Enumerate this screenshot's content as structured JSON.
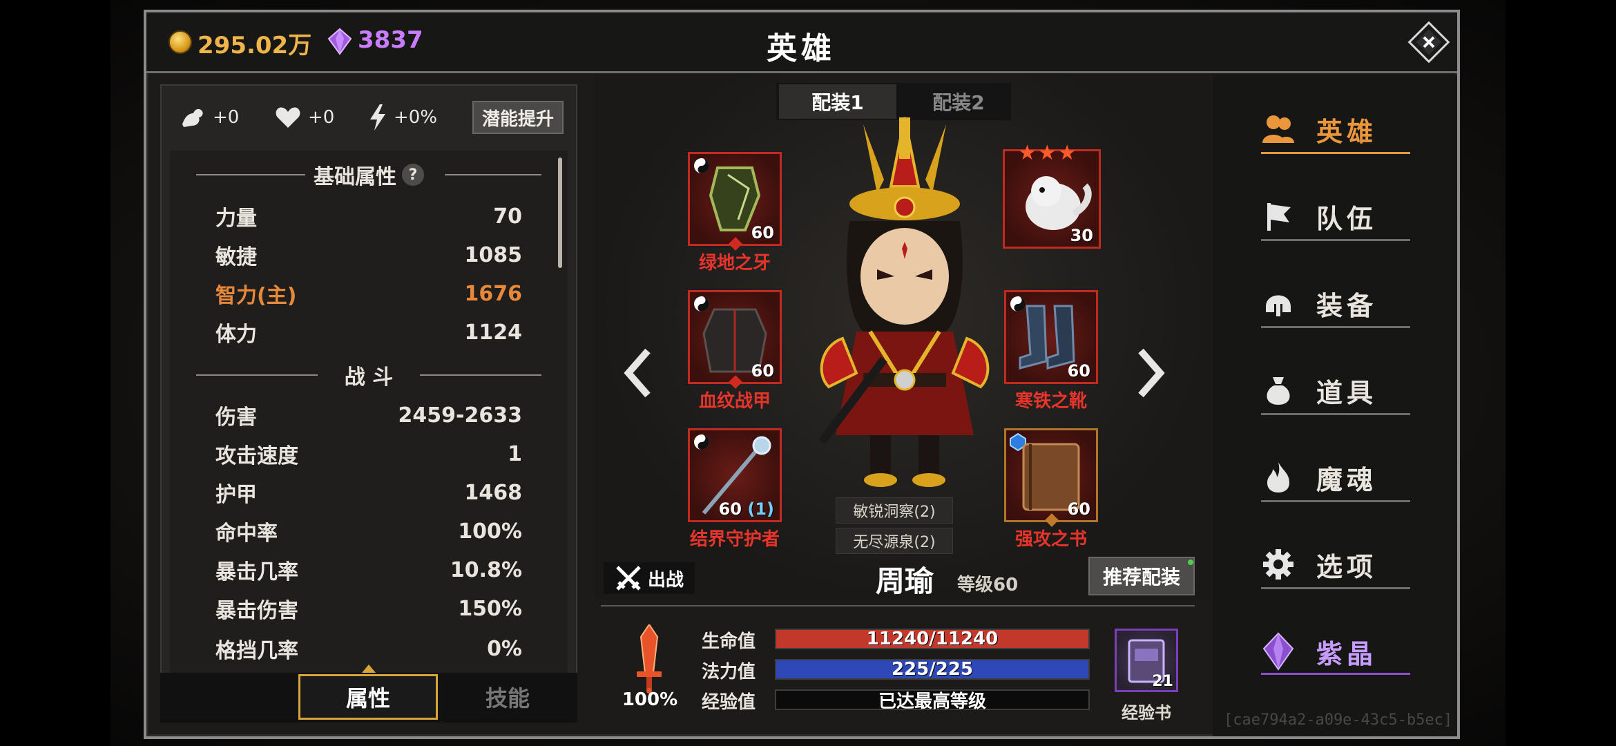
{
  "currency": {
    "gold": "295.02万",
    "gems": "3837"
  },
  "title": "英雄",
  "potential": {
    "strength_bonus": "+0",
    "health_bonus": "+0",
    "speed_bonus": "+0%",
    "upgrade_button": "潜能提升"
  },
  "basic_attributes": {
    "header": "基础属性",
    "help": "?",
    "rows": [
      {
        "label": "力量",
        "value": "70"
      },
      {
        "label": "敏捷",
        "value": "1085"
      },
      {
        "label": "智力(主)",
        "value": "1676"
      },
      {
        "label": "体力",
        "value": "1124"
      }
    ]
  },
  "combat": {
    "header": "战 斗",
    "rows": [
      {
        "label": "伤害",
        "value": "2459-2633"
      },
      {
        "label": "攻击速度",
        "value": "1"
      },
      {
        "label": "护甲",
        "value": "1468"
      },
      {
        "label": "命中率",
        "value": "100%"
      },
      {
        "label": "暴击几率",
        "value": "10.8%"
      },
      {
        "label": "暴击伤害",
        "value": "150%"
      },
      {
        "label": "格挡几率",
        "value": "0%"
      }
    ]
  },
  "left_tabs": {
    "attributes": "属性",
    "skills": "技能"
  },
  "loadouts": {
    "tab1": "配装1",
    "tab2": "配装2"
  },
  "equipment": {
    "weapon_top_left": {
      "name": "绿地之牙",
      "level": "60"
    },
    "pet": {
      "level": "30",
      "stars": "★★★"
    },
    "armor": {
      "name": "血纹战甲",
      "level": "60"
    },
    "boots": {
      "name": "寒铁之靴",
      "level": "60"
    },
    "staff": {
      "name": "结界守护者",
      "level": "60",
      "extra": "(1)"
    },
    "book": {
      "name": "强攻之书",
      "level": "60"
    }
  },
  "set_bonuses": {
    "set1": "敏锐洞察(2)",
    "set2": "无尽源泉(2)"
  },
  "hero": {
    "deploy": "出战",
    "name": "周瑜",
    "level": "等级60",
    "recommend": "推荐配装"
  },
  "vitals": {
    "power_percent": "100%",
    "hp_label": "生命值",
    "hp_value": "11240/11240",
    "hp_fill": 1.0,
    "mp_label": "法力值",
    "mp_value": "225/225",
    "mp_fill": 1.0,
    "exp_label": "经验值",
    "exp_value": "已达最高等级",
    "exp_fill": 0
  },
  "exp_book": {
    "count": "21",
    "label": "经验书"
  },
  "nav": [
    {
      "label": "英雄",
      "icon": "heroes-icon"
    },
    {
      "label": "队伍",
      "icon": "flag-icon"
    },
    {
      "label": "装备",
      "icon": "helmet-icon"
    },
    {
      "label": "道具",
      "icon": "bag-icon"
    },
    {
      "label": "魔魂",
      "icon": "flame-icon"
    },
    {
      "label": "选项",
      "icon": "gear-icon"
    },
    {
      "label": "紫晶",
      "icon": "crystal-icon"
    }
  ],
  "id_text": "[cae794a2-a09e-43c5-b5ec]",
  "colors": {
    "gold": "#f0b54a",
    "gem": "#c87cff",
    "primary_stat": "#e8893a",
    "item_name_red": "#e8342a",
    "hp_bar": "#c2392b",
    "mp_bar": "#2f48b8",
    "active_nav": "#e9963c"
  }
}
